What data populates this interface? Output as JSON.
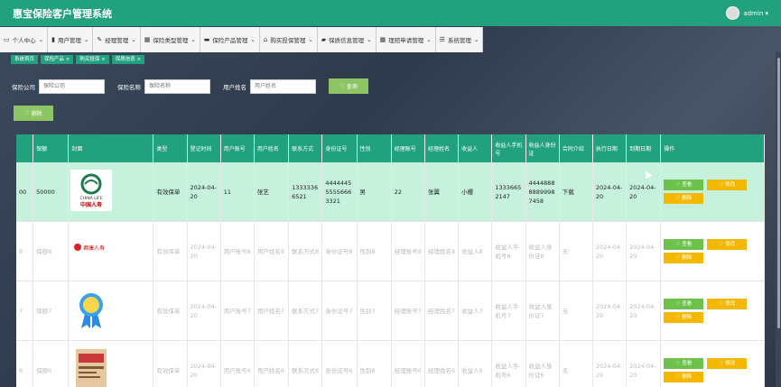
{
  "app": {
    "title": "惠宝保险客户管理系统",
    "user": "admin ▾"
  },
  "nav": [
    {
      "icon": "▭",
      "label": "个人中心",
      "caret": "⌄"
    },
    {
      "icon": "▮",
      "label": "用户管理",
      "caret": "⌄"
    },
    {
      "icon": "✎",
      "label": "经理管理",
      "caret": "⌄"
    },
    {
      "icon": "▦",
      "label": "保险类型管理",
      "caret": "⌄"
    },
    {
      "icon": "▬",
      "label": "保险产品管理",
      "caret": "⌄"
    },
    {
      "icon": "⌂",
      "label": "购买投保管理",
      "caret": "⌄"
    },
    {
      "icon": "▰",
      "label": "保质信息管理",
      "caret": "⌄"
    },
    {
      "icon": "▦",
      "label": "理赔申请管理",
      "caret": "⌄"
    },
    {
      "icon": "☰",
      "label": "系统管理",
      "caret": "⌄"
    }
  ],
  "tags": [
    "系统首页",
    "保险产品 ×",
    "购买投保 ×",
    "保质信息 ×"
  ],
  "search": {
    "company_label": "保险公司",
    "company_ph": "保险公司",
    "name_label": "保险名称",
    "name_ph": "保险名称",
    "user_label": "用户姓名",
    "user_ph": "用户姓名",
    "btn": "查询"
  },
  "delete_btn": "删除",
  "columns": [
    "",
    "保额",
    "封面",
    "类型",
    "登记时间",
    "用户账号",
    "用户姓名",
    "联系方式",
    "身份证号",
    "性别",
    "经理账号",
    "经理姓名",
    "收益人",
    "收益人手机号",
    "收益人身份证",
    "合同介绍",
    "执行日期",
    "到期日期",
    "操作"
  ],
  "ops": {
    "view": "查看",
    "edit": "修改",
    "del": "删除"
  },
  "rows": [
    {
      "idx": "00",
      "amount": "50000",
      "cover": "chinalife",
      "type": "有效保单",
      "date": "2024-04-20",
      "account": "11",
      "name": "张艺",
      "phone": "13333366521",
      "idcard": "444444555556663321",
      "gender": "男",
      "mgr_acct": "22",
      "mgr_name": "张翼",
      "benef": "小樱",
      "benef_phone": "13336652147",
      "benef_id": "444488888899987458",
      "contract": "下载",
      "exec": "2024-04-20",
      "expire": "2024-04-20"
    },
    {
      "idx": "8",
      "amount": "保额8",
      "cover": "life",
      "type": "有效保单",
      "date": "2024-04-20",
      "account": "用户账号8",
      "name": "用户姓名8",
      "phone": "联系方式8",
      "idcard": "身份证号8",
      "gender": "性别8",
      "mgr_acct": "经理账号8",
      "mgr_name": "经理姓名8",
      "benef": "收益人8",
      "benef_phone": "收益人手机号8",
      "benef_id": "收益人身份证8",
      "contract": "无",
      "exec": "2024-04-20",
      "expire": "2024-04-20"
    },
    {
      "idx": "7",
      "amount": "保额7",
      "cover": "medal",
      "type": "有效保单",
      "date": "2024-04-20",
      "account": "用户账号7",
      "name": "用户姓名7",
      "phone": "联系方式7",
      "idcard": "身份证号7",
      "gender": "性别7",
      "mgr_acct": "经理账号7",
      "mgr_name": "经理姓名7",
      "benef": "收益人7",
      "benef_phone": "收益人手机号7",
      "benef_id": "收益人身份证7",
      "contract": "无",
      "exec": "2024-04-20",
      "expire": "2024-04-20"
    },
    {
      "idx": "6",
      "amount": "保额6",
      "cover": "book",
      "type": "有效保单",
      "date": "2024-04-20",
      "account": "用户账号6",
      "name": "用户姓名6",
      "phone": "联系方式6",
      "idcard": "身份证号6",
      "gender": "性别6",
      "mgr_acct": "经理账号6",
      "mgr_name": "经理姓名6",
      "benef": "收益人6",
      "benef_phone": "收益人手机号6",
      "benef_id": "收益人身份证6",
      "contract": "无",
      "exec": "2024-04-20",
      "expire": "2024-04-20"
    }
  ],
  "cover_text": {
    "chinalife_en": "CHINA LIFE",
    "chinalife_cn": "中国人寿",
    "life_cn": "君康人寿"
  },
  "colors": {
    "primary": "#22a17e",
    "view": "#6cc24a",
    "edit": "#f5b800",
    "selected_row": "#c6f1dc"
  }
}
